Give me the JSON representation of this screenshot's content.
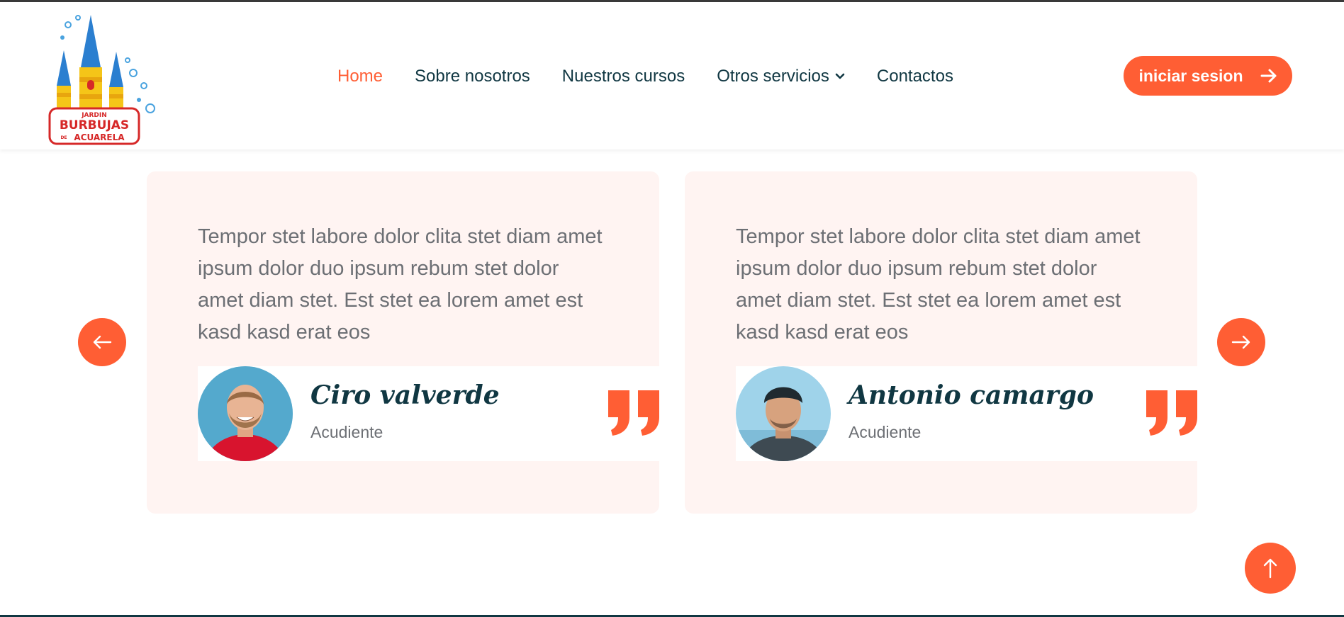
{
  "colors": {
    "accent": "#ff5e34",
    "dark": "#103742",
    "muted_text": "#6c6f74",
    "card_background": "#fff4f2"
  },
  "logo": {
    "line1": "JARDIN",
    "line2": "BURBUJAS",
    "line3": "DE",
    "line4": "ACUARELA"
  },
  "nav": {
    "items": [
      {
        "label": "Home",
        "active": true
      },
      {
        "label": "Sobre nosotros"
      },
      {
        "label": "Nuestros cursos"
      },
      {
        "label": "Otros servicios",
        "icon": "chevron-down-icon"
      },
      {
        "label": "Contactos"
      }
    ],
    "login_label": "iniciar sesion",
    "login_icon": "arrow-right-icon"
  },
  "carousel": {
    "prev_icon": "arrow-left-icon",
    "next_icon": "arrow-right-icon"
  },
  "testimonials": [
    {
      "text": "Tempor stet labore dolor clita stet diam amet ipsum dolor duo ipsum rebum stet dolor amet diam stet. Est stet ea lorem amet est kasd kasd erat eos",
      "name": "Ciro valverde",
      "role": "Acudiente",
      "icon": "quote-icon"
    },
    {
      "text": "Tempor stet labore dolor clita stet diam amet ipsum dolor duo ipsum rebum stet dolor amet diam stet. Est stet ea lorem amet est kasd kasd erat eos",
      "name": "Antonio camargo",
      "role": "Acudiente",
      "icon": "quote-icon"
    }
  ],
  "back_to_top_icon": "arrow-up-icon"
}
